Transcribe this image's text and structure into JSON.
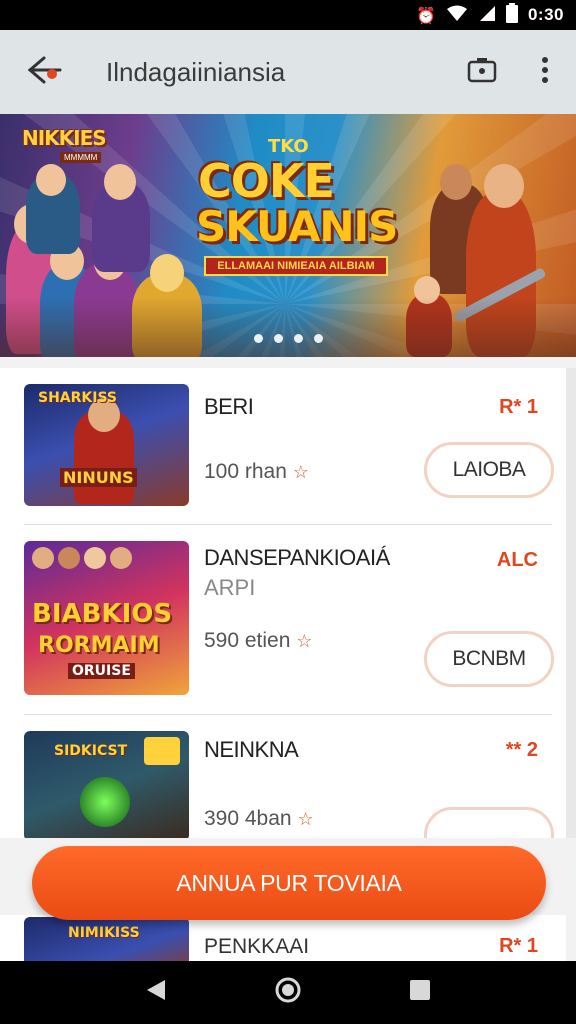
{
  "status_bar": {
    "time": "0:30",
    "icons": [
      "alarm-icon",
      "wifi-icon",
      "signal-icon",
      "battery-icon"
    ]
  },
  "app_bar": {
    "title": "Ilndagaiiniansia",
    "back_icon": "back-arrow-icon",
    "camera_icon": "camera-icon",
    "menu_icon": "more-vert-icon"
  },
  "banner": {
    "logo": "NIKKIES",
    "logo_sub": "MMMMM",
    "title_small": "TKO",
    "title_line1": "COKE",
    "title_line2": "SKUANIS",
    "ribbon": "ELLAMAAI NIMIEAIA AILBIAM",
    "dots_count": 4
  },
  "games": [
    {
      "title": "BERI",
      "meta": "100 rhan",
      "badge": "R* 1",
      "button": "LAIOBA",
      "thumb_title": "SHARKISS",
      "thumb_sub": "NINUNS"
    },
    {
      "title": "DANSEPANKIOAIÁ",
      "subtitle": "ARPI",
      "meta": "590 etien",
      "badge": "ALC",
      "button": "BCNBM",
      "thumb_title": "BIABKIOS",
      "thumb_sub": "RORMAIM",
      "thumb_sub2": "ORUISE"
    },
    {
      "title": "NEINKNA",
      "meta": "390 4ban",
      "badge": "** 2",
      "button": "",
      "thumb_title": "SIDKICST"
    }
  ],
  "cta": {
    "label": "ANNUA PUR TOVIAIA"
  },
  "peek_row": {
    "title": "PENKKAAI",
    "badge": "R* 1",
    "thumb_title": "NIMIKISS"
  },
  "colors": {
    "accent": "#ea4b12",
    "app_bar": "#dfe4e6",
    "badge": "#e0461f"
  }
}
